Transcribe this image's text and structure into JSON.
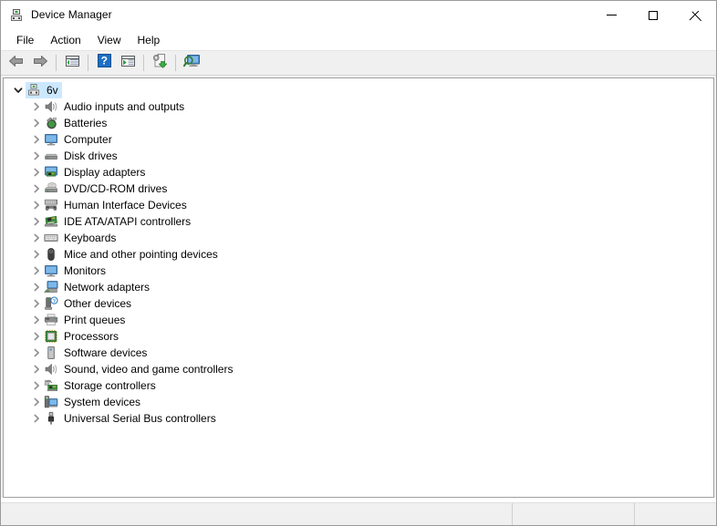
{
  "window": {
    "title": "Device Manager",
    "icon": "device-manager-icon",
    "minimize_label": "Minimize",
    "maximize_label": "Maximize",
    "close_label": "Close"
  },
  "menubar": {
    "items": [
      {
        "label": "File",
        "name": "menu-file"
      },
      {
        "label": "Action",
        "name": "menu-action"
      },
      {
        "label": "View",
        "name": "menu-view"
      },
      {
        "label": "Help",
        "name": "menu-help"
      }
    ]
  },
  "toolbar": {
    "buttons": [
      {
        "name": "back-button",
        "icon": "back-arrow-icon",
        "title": "Back"
      },
      {
        "name": "forward-button",
        "icon": "forward-arrow-icon",
        "title": "Forward"
      },
      {
        "name": "show-hide-console-tree-button",
        "icon": "console-tree-icon",
        "title": "Show/Hide Console Tree"
      },
      {
        "name": "help-button",
        "icon": "help-question-icon",
        "title": "Help"
      },
      {
        "name": "properties-button",
        "icon": "properties-window-icon",
        "title": "Properties"
      },
      {
        "name": "update-driver-button",
        "icon": "update-driver-icon",
        "title": "Update Driver Software"
      },
      {
        "name": "scan-hardware-changes-button",
        "icon": "scan-monitor-icon",
        "title": "Scan for hardware changes"
      }
    ]
  },
  "tree": {
    "root": {
      "label": "6v",
      "icon": "computer-node-icon",
      "expanded": true,
      "selected": true
    },
    "items": [
      {
        "label": "Audio inputs and outputs",
        "icon": "speaker-icon",
        "expanded": false
      },
      {
        "label": "Batteries",
        "icon": "battery-icon",
        "expanded": false
      },
      {
        "label": "Computer",
        "icon": "monitor-icon",
        "expanded": false
      },
      {
        "label": "Disk drives",
        "icon": "disk-drive-icon",
        "expanded": false
      },
      {
        "label": "Display adapters",
        "icon": "display-adapter-icon",
        "expanded": false
      },
      {
        "label": "DVD/CD-ROM drives",
        "icon": "dvd-drive-icon",
        "expanded": false
      },
      {
        "label": "Human Interface Devices",
        "icon": "hid-gamepad-icon",
        "expanded": false
      },
      {
        "label": "IDE ATA/ATAPI controllers",
        "icon": "ide-controller-icon",
        "expanded": false
      },
      {
        "label": "Keyboards",
        "icon": "keyboard-icon",
        "expanded": false
      },
      {
        "label": "Mice and other pointing devices",
        "icon": "mouse-icon",
        "expanded": false
      },
      {
        "label": "Monitors",
        "icon": "monitor-icon",
        "expanded": false
      },
      {
        "label": "Network adapters",
        "icon": "network-adapter-icon",
        "expanded": false
      },
      {
        "label": "Other devices",
        "icon": "other-device-question-icon",
        "expanded": false
      },
      {
        "label": "Print queues",
        "icon": "printer-icon",
        "expanded": false
      },
      {
        "label": "Processors",
        "icon": "processor-chip-icon",
        "expanded": false
      },
      {
        "label": "Software devices",
        "icon": "software-device-icon",
        "expanded": false
      },
      {
        "label": "Sound, video and game controllers",
        "icon": "speaker-icon",
        "expanded": false
      },
      {
        "label": "Storage controllers",
        "icon": "storage-controller-icon",
        "expanded": false
      },
      {
        "label": "System devices",
        "icon": "system-device-icon",
        "expanded": false
      },
      {
        "label": "Universal Serial Bus controllers",
        "icon": "usb-icon",
        "expanded": false
      }
    ]
  },
  "statusbar": {
    "panes": [
      "",
      "",
      ""
    ]
  },
  "colors": {
    "selection": "#cce8ff",
    "toolbar_bg": "#f0f0f0",
    "window_border": "#9a9a9a",
    "text": "#000000"
  }
}
